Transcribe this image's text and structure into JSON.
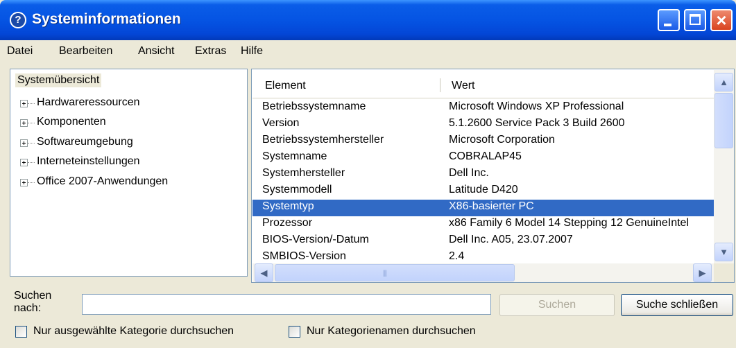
{
  "window": {
    "title": "Systeminformationen",
    "app_icon": "?",
    "controls": {
      "minimize": "minimize-icon",
      "maximize": "maximize-icon",
      "close": "×"
    }
  },
  "menu": [
    "Datei",
    "Bearbeiten",
    "Ansicht",
    "Extras",
    "Hilfe"
  ],
  "tree": {
    "root": "Systemübersicht",
    "nodes": [
      "Hardwareressourcen",
      "Komponenten",
      "Softwareumgebung",
      "Interneteinstellungen",
      "Office 2007-Anwendungen"
    ]
  },
  "list": {
    "columns": [
      "Element",
      "Wert"
    ],
    "rows": [
      {
        "element": "Betriebssystemname",
        "value": "Microsoft Windows XP Professional"
      },
      {
        "element": "Version",
        "value": "5.1.2600 Service Pack 3 Build 2600"
      },
      {
        "element": "Betriebssystemhersteller",
        "value": "Microsoft Corporation"
      },
      {
        "element": "Systemname",
        "value": "COBRALAP45"
      },
      {
        "element": "Systemhersteller",
        "value": "Dell Inc."
      },
      {
        "element": "Systemmodell",
        "value": "Latitude D420"
      },
      {
        "element": "Systemtyp",
        "value": "X86-basierter PC",
        "selected": true
      },
      {
        "element": "Prozessor",
        "value": "x86 Family 6 Model 14 Stepping 12 GenuineIntel"
      },
      {
        "element": "BIOS-Version/-Datum",
        "value": "Dell Inc. A05, 23.07.2007"
      },
      {
        "element": "SMBIOS-Version",
        "value": "2.4"
      }
    ],
    "scroll_arrows": {
      "up": "▲",
      "down": "▼",
      "left": "◀",
      "right": "▶"
    },
    "grip": "|||"
  },
  "search": {
    "label": "Suchen nach:",
    "value": "",
    "search_button": "Suchen",
    "close_button": "Suche schließen",
    "checkbox_category": "Nur ausgewählte Kategorie durchsuchen",
    "checkbox_names": "Nur Kategorienamen durchsuchen"
  },
  "colors": {
    "titlebar": "#0554e3",
    "selection": "#316ac5",
    "face": "#ece9d8"
  }
}
